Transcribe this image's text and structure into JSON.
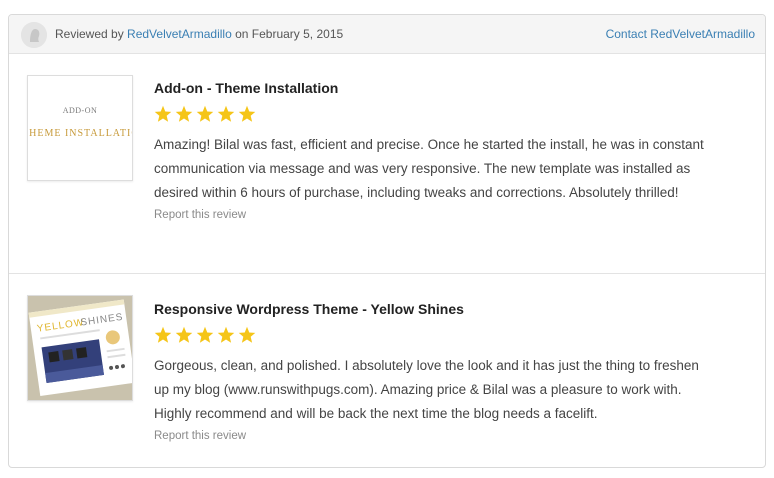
{
  "header": {
    "avatar_icon": "user-avatar-icon",
    "reviewed_prefix": "Reviewed by ",
    "reviewer_name": "RedVelvetArmadillo",
    "reviewed_suffix": " on February 5, 2015",
    "contact_label": "Contact RedVelvetArmadillo",
    "link_color": "#3a7fb3"
  },
  "star_color": "#f5c518",
  "reviews": [
    {
      "product_title": "Add-on - Theme Installation",
      "thumbnail": {
        "line1": "ADD-ON",
        "line2": "THEME INSTALLATION"
      },
      "rating": 5,
      "body": "Amazing! Bilal was fast, efficient and precise. Once he started the install, he was in constant communication via message and was very responsive. The new template was installed as desired within 6 hours of purchase, including tweaks and corrections. Absolutely thrilled!",
      "report_label": "Report this review"
    },
    {
      "product_title": "Responsive Wordpress Theme - Yellow Shines",
      "thumbnail": {
        "line1": "YELLOW",
        "line2": "SHINES"
      },
      "rating": 5,
      "body": "Gorgeous, clean, and polished. I absolutely love the look and it has just the thing to freshen up my blog (www.runswithpugs.com). Amazing price & Bilal was a pleasure to work with. Highly recommend and will be back the next time the blog needs a facelift.",
      "report_label": "Report this review"
    }
  ]
}
